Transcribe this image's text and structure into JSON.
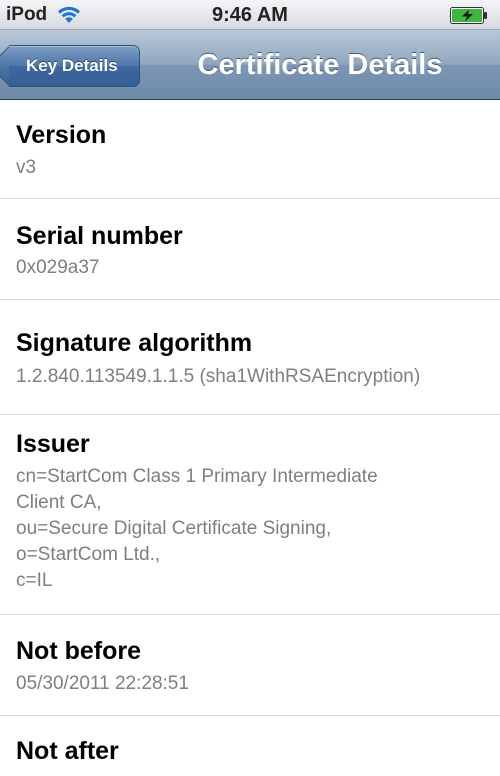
{
  "status_bar": {
    "carrier": "iPod",
    "time": "9:46 AM",
    "wifi_icon": "wifi-icon",
    "battery_icon": "battery-charging-icon",
    "battery_color": "#3cb83c"
  },
  "nav_bar": {
    "back_label": "Key Details",
    "title": "Certificate Details",
    "tint_color": "#6e8bab"
  },
  "fields": [
    {
      "label": "Version",
      "lines": [
        "v3"
      ]
    },
    {
      "label": "Serial number",
      "lines": [
        "0x029a37"
      ]
    },
    {
      "label": "Signature algorithm",
      "lines": [
        "1.2.840.113549.1.1.5 (sha1WithRSAEncryption)"
      ]
    },
    {
      "label": "Issuer",
      "lines": [
        "cn=StartCom Class 1 Primary Intermediate",
        "Client CA,",
        "ou=Secure Digital Certificate Signing,",
        "o=StartCom Ltd.,",
        "c=IL"
      ]
    },
    {
      "label": "Not before",
      "lines": [
        "05/30/2011 22:28:51"
      ]
    },
    {
      "label": "Not after",
      "lines": []
    }
  ]
}
